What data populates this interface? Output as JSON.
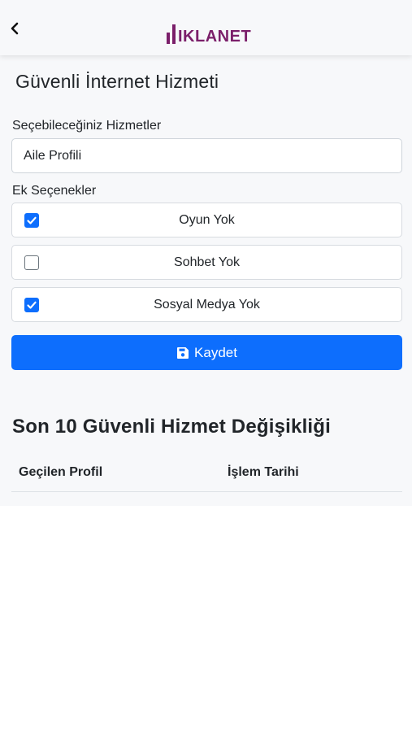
{
  "header": {
    "back_icon": "chevron-left-icon",
    "logo_text": "IKLANET",
    "logo_color": "#7b1f6a"
  },
  "page": {
    "title": "Güvenli İnternet Hizmeti"
  },
  "services": {
    "label": "Seçebileceğiniz Hizmetler",
    "selected": "Aile Profili"
  },
  "extras": {
    "label": "Ek Seçenekler",
    "options": [
      {
        "label": "Oyun Yok",
        "checked": true
      },
      {
        "label": "Sohbet Yok",
        "checked": false
      },
      {
        "label": "Sosyal Medya Yok",
        "checked": true
      }
    ]
  },
  "actions": {
    "save_label": "Kaydet",
    "save_icon": "floppy-disk-icon",
    "accent_color": "#0d6efd"
  },
  "history": {
    "title": "Son 10 Güvenli Hizmet Değişikliği",
    "columns": [
      "Geçilen Profil",
      "İşlem Tarihi"
    ],
    "rows": []
  }
}
